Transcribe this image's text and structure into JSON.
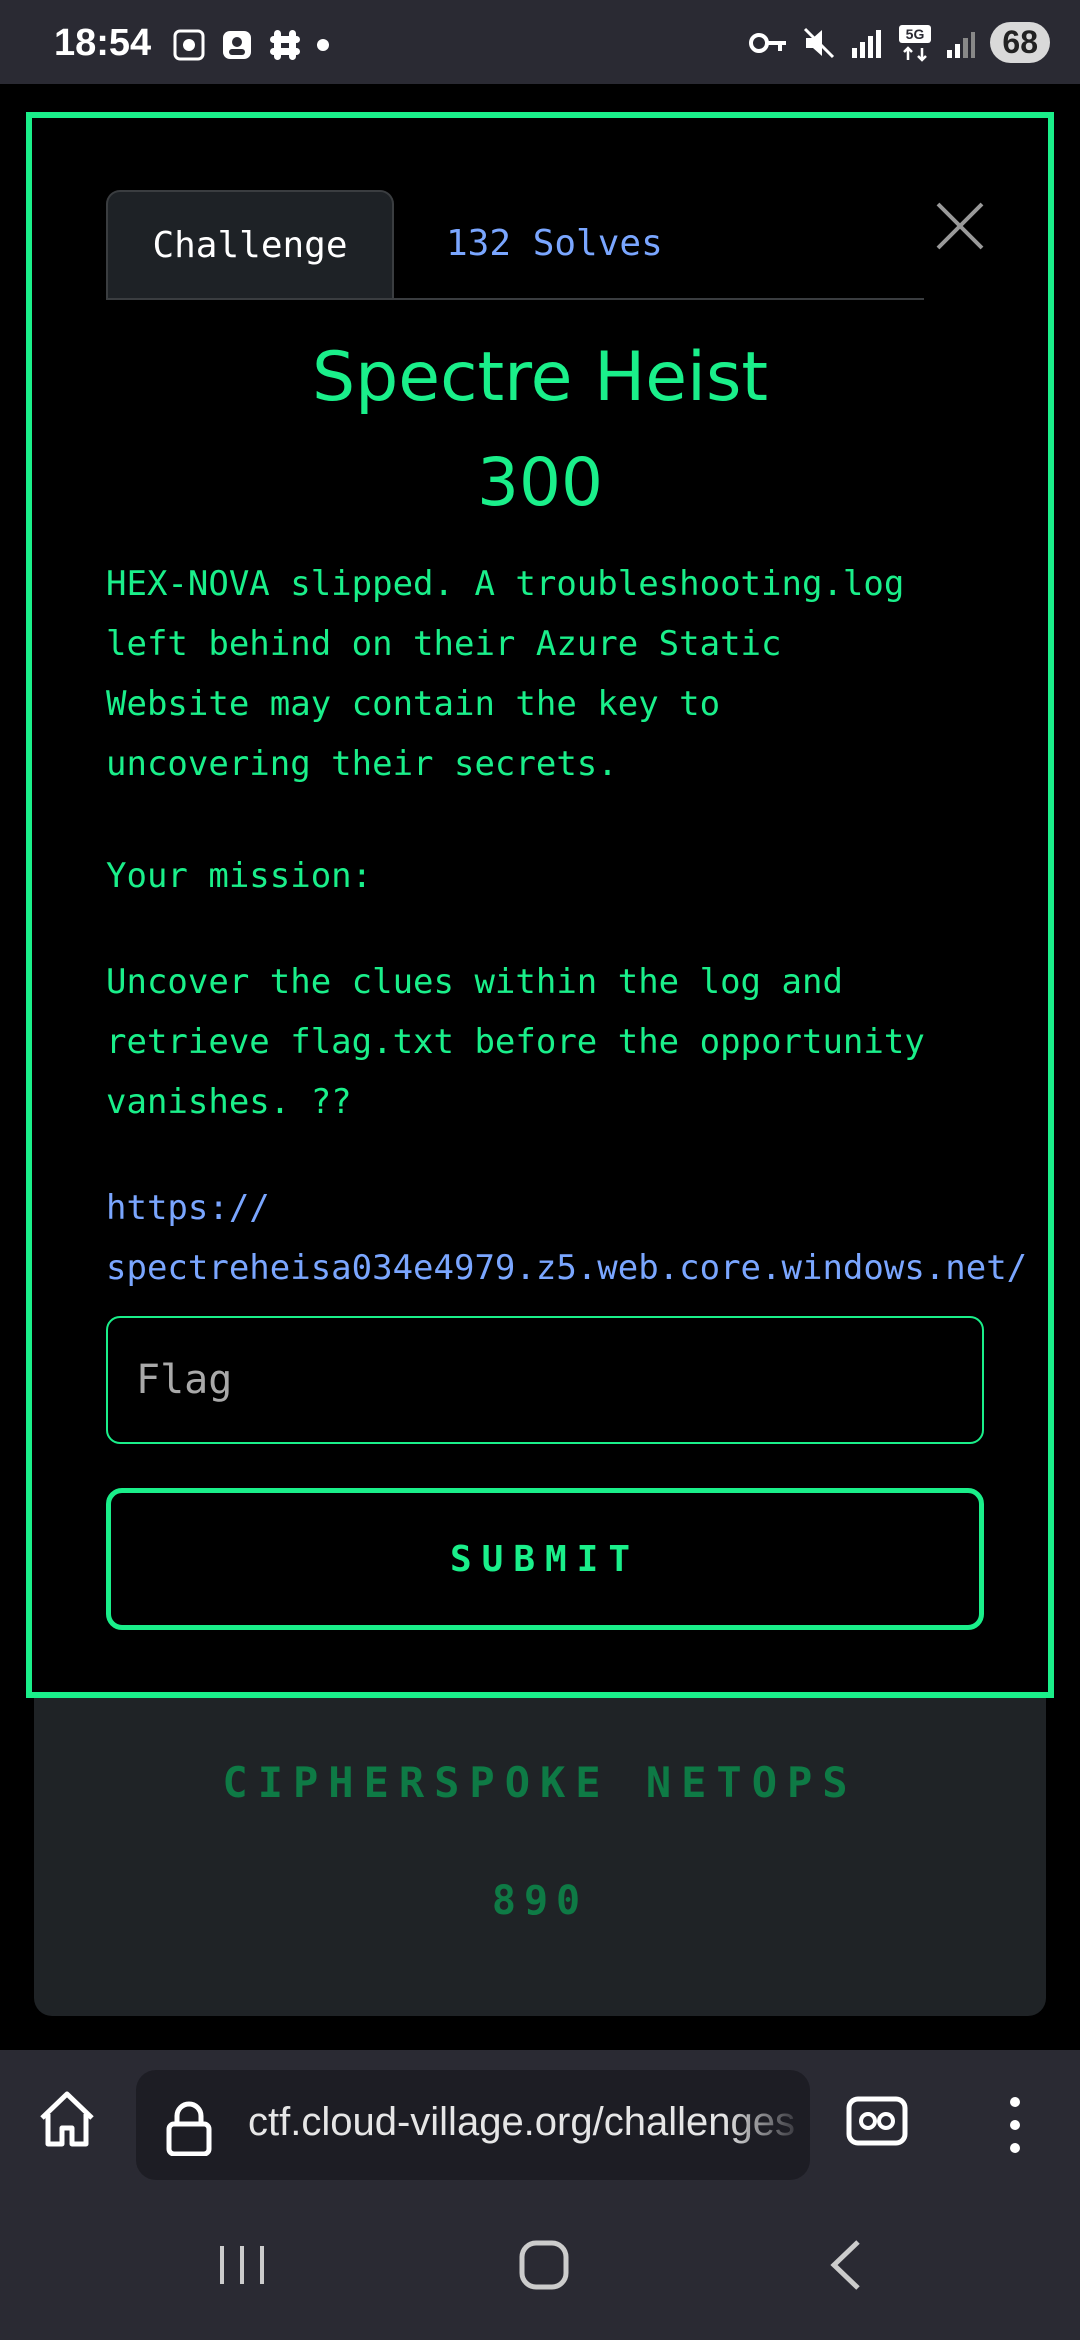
{
  "status_bar": {
    "time": "18:54",
    "battery": "68",
    "network": "5G"
  },
  "modal": {
    "tabs": [
      {
        "label": "Challenge",
        "active": true
      },
      {
        "label": "132 Solves",
        "active": false
      }
    ],
    "title": "Spectre Heist",
    "points": "300",
    "description_1": "HEX-NOVA slipped. A troubleshooting.log\nleft behind on their Azure Static\nWebsite may contain the key to\nuncovering their secrets.",
    "description_2": "Your mission:",
    "description_3": "Uncover the clues within the log and\nretrieve flag.txt before the opportunity\nvanishes. ??",
    "link": "https://\nspectreheisa034e4979.z5.web.core.windows.net/",
    "flag_placeholder": "Flag",
    "submit_label": "SUBMIT"
  },
  "background_card": {
    "title": "CIPHERSPOKE NETOPS",
    "points": "890"
  },
  "browser": {
    "url": "ctf.cloud-village.org/challenges"
  },
  "colors": {
    "accent": "#1aef8a",
    "link": "#7aa6ff",
    "background": "#000000",
    "system_bar": "#2a2a33"
  }
}
